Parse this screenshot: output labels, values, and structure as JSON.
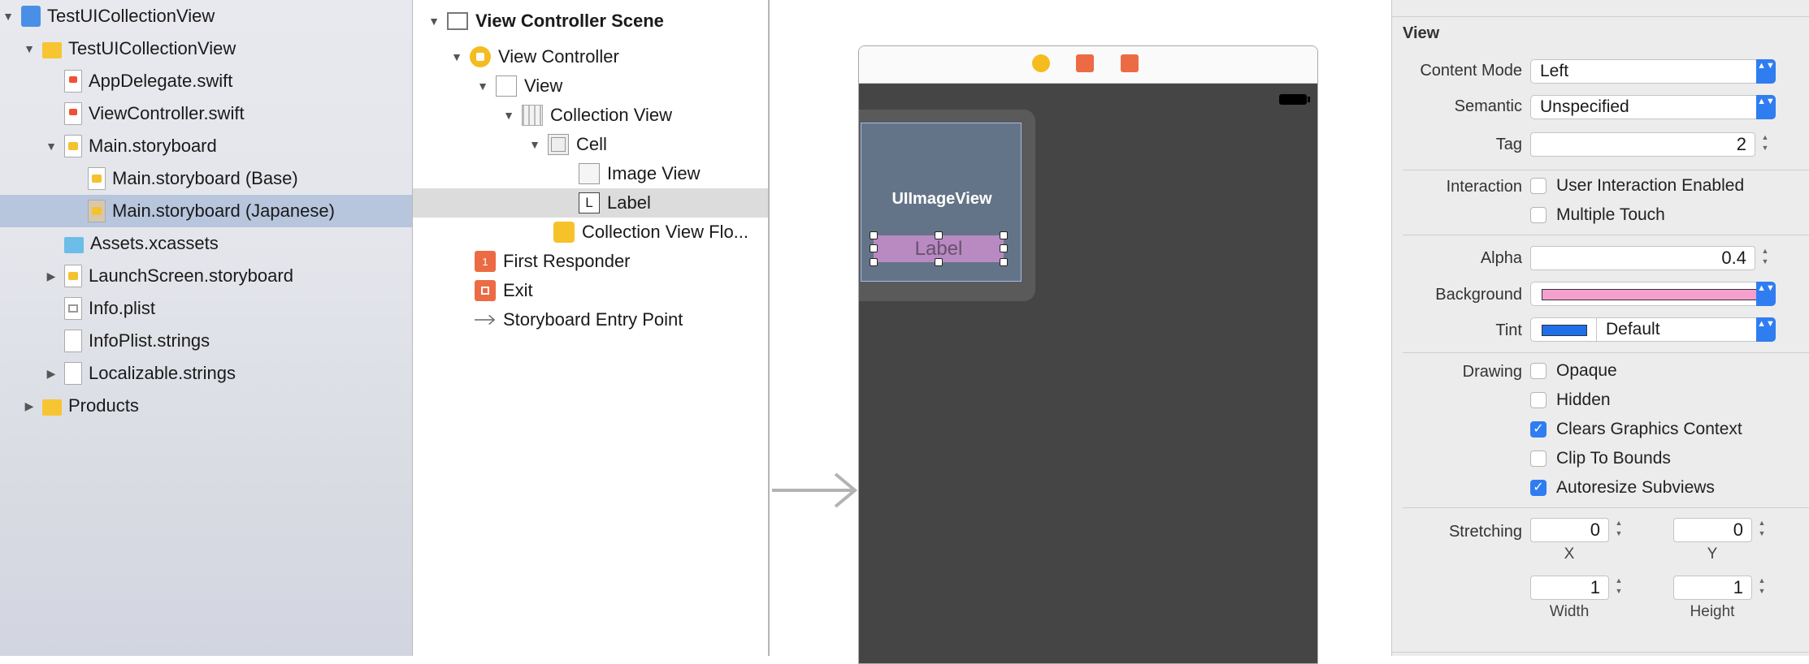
{
  "navigator": {
    "items": [
      {
        "label": "TestUICollectionView",
        "icon": "project-icon",
        "disclosure": "▼",
        "depth": 0
      },
      {
        "label": "TestUICollectionView",
        "icon": "folder-icon",
        "disclosure": "▼",
        "depth": 1
      },
      {
        "label": "AppDelegate.swift",
        "icon": "swift-file-icon",
        "disclosure": "",
        "depth": 2
      },
      {
        "label": "ViewController.swift",
        "icon": "swift-file-icon",
        "disclosure": "",
        "depth": 2
      },
      {
        "label": "Main.storyboard",
        "icon": "storyboard-icon",
        "disclosure": "▼",
        "depth": 2
      },
      {
        "label": "Main.storyboard (Base)",
        "icon": "storyboard-icon",
        "disclosure": "",
        "depth": 3
      },
      {
        "label": "Main.storyboard (Japanese)",
        "icon": "storyboard-icon",
        "disclosure": "",
        "depth": 3
      },
      {
        "label": "Assets.xcassets",
        "icon": "asset-catalog-icon",
        "disclosure": "",
        "depth": 2
      },
      {
        "label": "LaunchScreen.storyboard",
        "icon": "storyboard-icon",
        "disclosure": "▶",
        "depth": 2
      },
      {
        "label": "Info.plist",
        "icon": "plist-icon",
        "disclosure": "",
        "depth": 2
      },
      {
        "label": "InfoPlist.strings",
        "icon": "strings-file-icon",
        "disclosure": "",
        "depth": 2
      },
      {
        "label": "Localizable.strings",
        "icon": "strings-file-icon",
        "disclosure": "▶",
        "depth": 2
      },
      {
        "label": "Products",
        "icon": "folder-icon",
        "disclosure": "▶",
        "depth": 1
      }
    ]
  },
  "outline": {
    "items": [
      {
        "label": "View Controller Scene",
        "icon": "scene-icon",
        "disclosure": "▼"
      },
      {
        "label": "View Controller",
        "icon": "view-controller-icon",
        "disclosure": "▼"
      },
      {
        "label": "View",
        "icon": "view-icon",
        "disclosure": "▼"
      },
      {
        "label": "Collection View",
        "icon": "collection-view-icon",
        "disclosure": "▼"
      },
      {
        "label": "Cell",
        "icon": "cell-icon",
        "disclosure": "▼"
      },
      {
        "label": "Image View",
        "icon": "image-view-icon",
        "disclosure": ""
      },
      {
        "label": "Label",
        "icon": "label-icon",
        "disclosure": ""
      },
      {
        "label": "Collection View Flo...",
        "icon": "flow-layout-icon",
        "disclosure": ""
      },
      {
        "label": "First Responder",
        "icon": "first-responder-icon",
        "disclosure": ""
      },
      {
        "label": "Exit",
        "icon": "exit-icon",
        "disclosure": ""
      },
      {
        "label": "Storyboard Entry Point",
        "icon": "entry-point-icon",
        "disclosure": ""
      }
    ],
    "label_icon_letter": "L",
    "first_responder_glyph": "1"
  },
  "canvas": {
    "image_view_text": "UIImageView",
    "label_text": "Label"
  },
  "inspector": {
    "section_title": "View",
    "content_mode": {
      "label": "Content Mode",
      "value": "Left"
    },
    "semantic": {
      "label": "Semantic",
      "value": "Unspecified"
    },
    "tag": {
      "label": "Tag",
      "value": "2"
    },
    "interaction": {
      "label": "Interaction",
      "options": [
        {
          "text": "User Interaction Enabled",
          "checked": false
        },
        {
          "text": "Multiple Touch",
          "checked": false
        }
      ]
    },
    "alpha": {
      "label": "Alpha",
      "value": "0.4"
    },
    "background": {
      "label": "Background",
      "swatch_color": "#f59fcf"
    },
    "tint": {
      "label": "Tint",
      "value": "Default",
      "swatch_color": "#1f6fe8"
    },
    "drawing": {
      "label": "Drawing",
      "options": [
        {
          "text": "Opaque",
          "checked": false
        },
        {
          "text": "Hidden",
          "checked": false
        },
        {
          "text": "Clears Graphics Context",
          "checked": true
        },
        {
          "text": "Clip To Bounds",
          "checked": false
        },
        {
          "text": "Autoresize Subviews",
          "checked": true
        }
      ]
    },
    "stretching": {
      "label": "Stretching",
      "x": "0",
      "y": "0",
      "width": "1",
      "height": "1",
      "x_label": "X",
      "y_label": "Y",
      "width_label": "Width",
      "height_label": "Height"
    },
    "checkmark": "✓",
    "popup_arrows": "▲▼"
  },
  "colors": {
    "selection_nav": "#b7c6dd",
    "accent_blue": "#2f7df1",
    "canvas_dark": "#454545"
  }
}
